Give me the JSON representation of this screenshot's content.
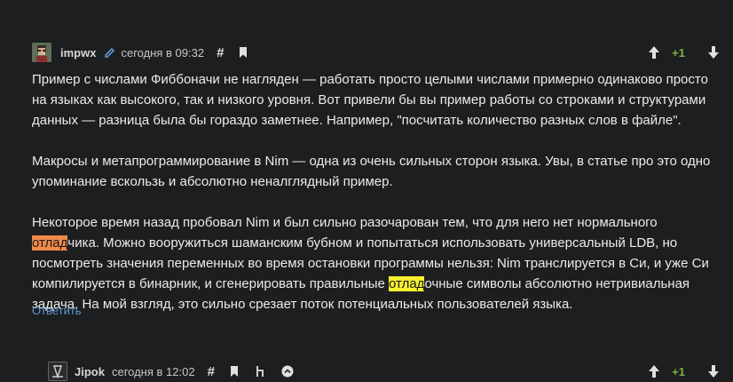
{
  "comment": {
    "username": "impwx",
    "timestamp": "сегодня в 09:32",
    "score": "+1",
    "paragraphs": {
      "p1": "Пример с числами Фиббоначи не нагляден — работать просто целыми числами примерно одинаково просто на языках как высокого, так и низкого уровня. Вот привели бы вы пример работы со строками и структурами данных — разница была бы гораздо заметнее. Например, \"посчитать количество разных слов в файле\".",
      "p2": "Макросы и метапрограммирование в Nim — одна из очень сильных сторон языка. Увы, в статье про это одно упоминание вскользь и абсолютно неналглядный пример.",
      "p3a": "Некоторое время назад пробовал Nim и был сильно разочарован тем, что для него нет нормального ",
      "p3_hl1": "отлад",
      "p3b": "чика. Можно вооружиться шаманским бубном и попытаться использовать универсальный LDB, но посмотреть значения переменных во время остановки программы нельзя: Nim транслируется в Си, и уже Си компилируется в бинарник, и сгенерировать правильные ",
      "p3_hl2": "отлад",
      "p3c": "очные символы абсолютно нетривиальная задача. На мой взгляд, это сильно срезает поток потенциальных пользователей языка."
    },
    "reply_label": "Ответить"
  },
  "child_comment": {
    "username": "Jipok",
    "timestamp": "сегодня в 12:02",
    "score": "+1"
  },
  "colors": {
    "background": "#1d1e20",
    "score_positive": "#7cb342",
    "link": "#5d9ad0",
    "highlight_orange": "#f08a4b",
    "highlight_yellow": "#f7ef2e"
  },
  "icons": {
    "edit": "pencil-icon",
    "anchor": "hash-icon",
    "bookmark": "bookmark-icon",
    "vote_up": "arrow-up-icon",
    "vote_down": "arrow-down-icon",
    "parent": "parent-link-icon",
    "collapse": "chevron-up-icon"
  }
}
